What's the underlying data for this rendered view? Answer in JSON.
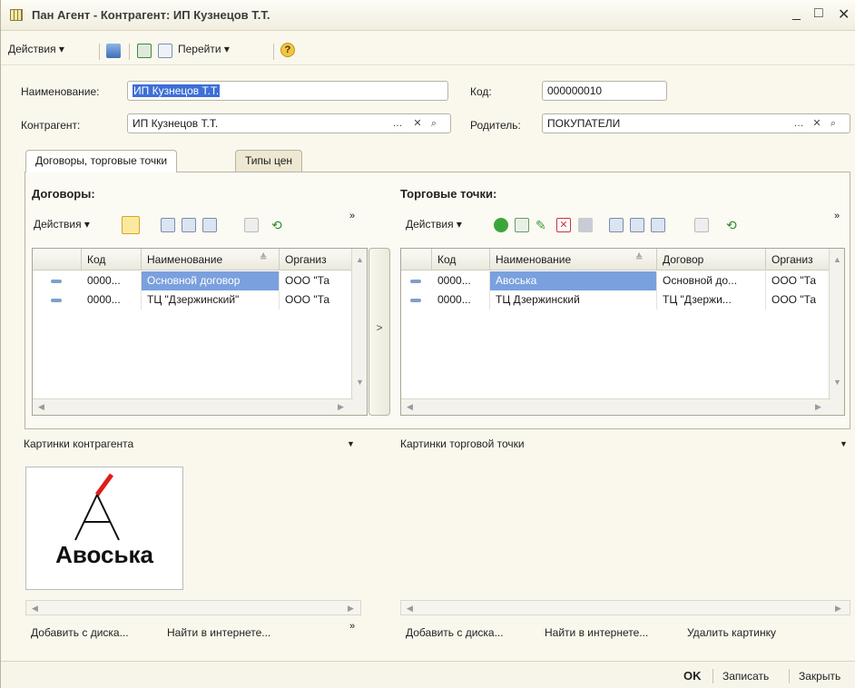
{
  "window": {
    "title": "Пан Агент - Контрагент: ИП Кузнецов Т.Т.",
    "min": "_",
    "max": "□",
    "close": "✕"
  },
  "toolbar": {
    "actions": "Действия ▾",
    "goto": "Перейти ▾",
    "help": "?"
  },
  "form": {
    "name_label": "Наименование:",
    "name_value": "ИП Кузнецов Т.Т.",
    "code_label": "Код:",
    "code_value": "000000010",
    "counterparty_label": "Контрагент:",
    "counterparty_value": "ИП Кузнецов Т.Т.",
    "parent_label": "Родитель:",
    "parent_value": "ПОКУПАТЕЛИ"
  },
  "tabs": [
    {
      "label": "Договоры, торговые точки"
    },
    {
      "label": "Типы цен"
    }
  ],
  "contracts": {
    "title": "Договоры:",
    "actions": "Действия ▾",
    "columns": [
      "Код",
      "Наименование",
      "Организ"
    ],
    "rows": [
      [
        "0000...",
        "Основной договор",
        "ООО \"Та"
      ],
      [
        "0000...",
        "ТЦ \"Дзержинский\"",
        "ООО \"Та"
      ]
    ]
  },
  "outlets": {
    "title": "Торговые точки:",
    "actions": "Действия ▾",
    "columns": [
      "Код",
      "Наименование",
      "Договор",
      "Организ"
    ],
    "rows": [
      [
        "0000...",
        "Авоська",
        "Основной до...",
        "ООО \"Та"
      ],
      [
        "0000...",
        "ТЦ Дзержинский",
        "ТЦ \"Дзержи...",
        "ООО \"Та"
      ]
    ]
  },
  "splitter": ">",
  "pictures": {
    "counterparty_label": "Картинки контрагента",
    "outlet_label": "Картинки торговой точки",
    "logo_text": "Авоська",
    "add_from_disk": "Добавить с диска...",
    "find_online": "Найти в интернете...",
    "delete_picture": "Удалить картинку"
  },
  "footer": {
    "ok": "OK",
    "save": "Записать",
    "close": "Закрыть"
  },
  "colors": {
    "selection": "#3d6fd6",
    "row_highlight": "#7aa0de"
  }
}
